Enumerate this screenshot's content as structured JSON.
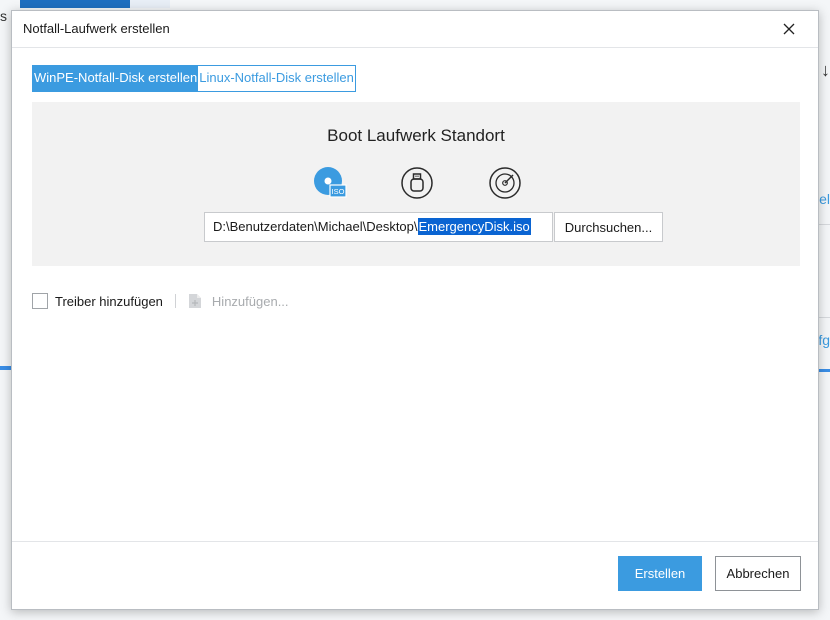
{
  "dialog": {
    "title": "Notfall-Laufwerk erstellen"
  },
  "tabs": [
    {
      "label": "WinPE-Notfall-Disk erstellen",
      "active": true
    },
    {
      "label": "Linux-Notfall-Disk erstellen",
      "active": false
    }
  ],
  "boot": {
    "title": "Boot Laufwerk Standort",
    "options": [
      {
        "icon": "iso-disc-icon",
        "selected": true
      },
      {
        "icon": "usb-drive-icon",
        "selected": false
      },
      {
        "icon": "cd-dvd-icon",
        "selected": false
      }
    ],
    "iso_badge": "ISO",
    "path_prefix": "D:\\Benutzerdaten\\Michael\\Desktop\\",
    "path_selected": "EmergencyDisk.iso",
    "browse_label": "Durchsuchen..."
  },
  "driver": {
    "checkbox_label": "Treiber hinzufügen",
    "checked": false,
    "add_label": "Hinzufügen..."
  },
  "footer": {
    "create_label": "Erstellen",
    "cancel_label": "Abbrechen"
  },
  "colors": {
    "accent": "#3b9be0",
    "selection": "#0a64d2",
    "panel_bg": "#f2f2f2"
  }
}
